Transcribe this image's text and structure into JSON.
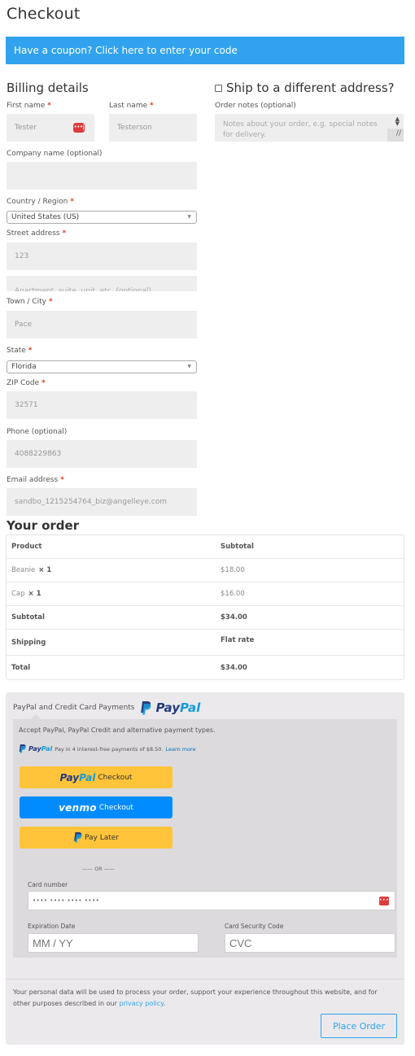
{
  "page": {
    "title": "Checkout"
  },
  "coupon": {
    "text": "Have a coupon? Click here to enter your code"
  },
  "billing": {
    "title": "Billing details",
    "required_marker": "*",
    "first_name": {
      "label": "First name",
      "value": "Tester"
    },
    "last_name": {
      "label": "Last name",
      "value": "Testerson"
    },
    "company": {
      "label": "Company name (optional)",
      "value": ""
    },
    "country": {
      "label": "Country / Region",
      "selected": "United States (US)"
    },
    "street": {
      "label": "Street address",
      "value": "123",
      "line2_placeholder": "Apartment, suite, unit, etc. (optional)"
    },
    "city": {
      "label": "Town / City",
      "value": "Pace"
    },
    "state": {
      "label": "State",
      "selected": "Florida"
    },
    "zip": {
      "label": "ZIP Code",
      "value": "32571"
    },
    "phone": {
      "label": "Phone (optional)",
      "value": "4088229863"
    },
    "email": {
      "label": "Email address",
      "value": "sandbo_1215254764_biz@angelleye.com"
    }
  },
  "shipping": {
    "title": "Ship to a different address?",
    "checked": false,
    "order_notes": {
      "label": "Order notes (optional)",
      "placeholder": "Notes about your order, e.g. special notes for delivery."
    }
  },
  "order": {
    "title": "Your order",
    "headers": {
      "product": "Product",
      "subtotal": "Subtotal"
    },
    "items": [
      {
        "name": "Beanie",
        "qty": "× 1",
        "price": "$18.00"
      },
      {
        "name": "Cap",
        "qty": "× 1",
        "price": "$16.00"
      }
    ],
    "subtotal": {
      "label": "Subtotal",
      "value": "$34.00"
    },
    "shipping": {
      "label": "Shipping",
      "value": "Flat rate"
    },
    "total": {
      "label": "Total",
      "value": "$34.00"
    }
  },
  "payment": {
    "method_label": "PayPal and Credit Card Payments",
    "brand_pay": "Pay",
    "brand_pal": "Pal",
    "description": "Accept PayPal, PayPal Credit and alternative payment types.",
    "pay_in_4": "Pay in 4 interest-free payments of $8.50.",
    "learn_more": "Learn more",
    "buttons": {
      "paypal_suffix": "Checkout",
      "venmo_brand": "venmo",
      "venmo_suffix": "Checkout",
      "pay_later": "Pay Later"
    },
    "or_text": "—— OR ——",
    "card": {
      "number_label": "Card number",
      "number_placeholder": "•••• •••• •••• ••••",
      "exp_label": "Expiration Date",
      "exp_placeholder": "MM / YY",
      "cvc_label": "Card Security Code",
      "cvc_placeholder": "CVC"
    }
  },
  "footer": {
    "privacy_text": "Your personal data will be used to process your order, support your experience throughout this website, and for other purposes described in our ",
    "privacy_link": "privacy policy",
    "privacy_end": ".",
    "place_order": "Place Order"
  },
  "icons": {
    "password_manager": "•••|",
    "select_arrow": "▼",
    "spinner": "▲▼",
    "resize_grip": "//"
  },
  "colors": {
    "accent": "#31a3ee",
    "required": "#e2401c",
    "paypal_yellow": "#ffc439",
    "venmo_blue": "#008cff",
    "paypal_dark": "#253b80",
    "paypal_light": "#179bd7"
  }
}
